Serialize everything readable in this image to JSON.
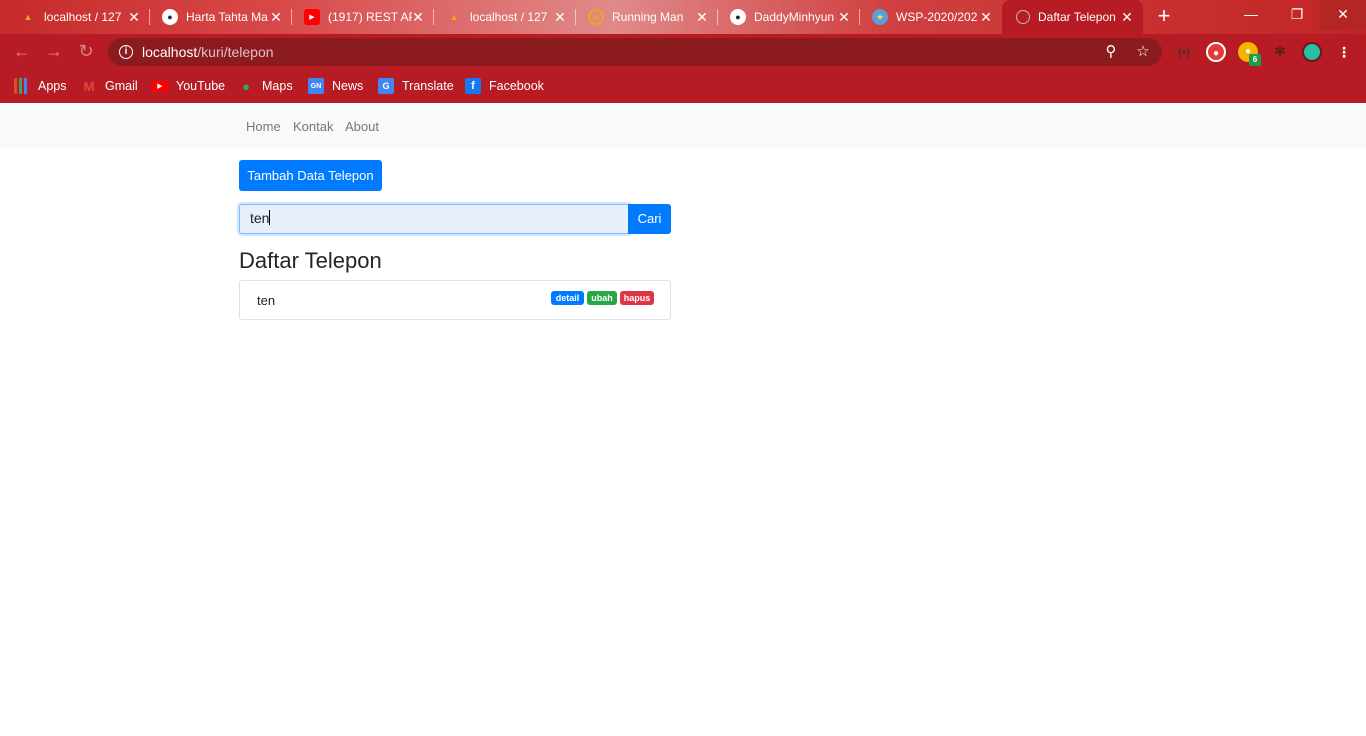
{
  "browser": {
    "tabs": [
      {
        "title": "localhost / 127",
        "favicon": "phpmyadmin-icon",
        "color": "#f4a21a"
      },
      {
        "title": "Harta Tahta Ma",
        "favicon": "avatar-icon",
        "color": "#ffffff"
      },
      {
        "title": "(1917) REST AP",
        "favicon": "youtube-icon",
        "color": "#ff0000"
      },
      {
        "title": "localhost / 127",
        "favicon": "phpmyadmin-icon",
        "color": "#f4a21a"
      },
      {
        "title": "Running Man",
        "favicon": "play-icon",
        "color": "#f7a21b"
      },
      {
        "title": "DaddyMinhyun",
        "favicon": "github-icon",
        "color": "#ffffff"
      },
      {
        "title": "WSP-2020/202",
        "favicon": "university-icon",
        "color": "#5aa0d8"
      },
      {
        "title": "Daftar Telepon",
        "favicon": "globe-icon",
        "color": "#c8c8c8",
        "active": true
      }
    ],
    "url_host": "localhost",
    "url_path": "/kuri/telepon",
    "bookmarks": [
      {
        "label": "Apps",
        "icon": "apps-grid-icon"
      },
      {
        "label": "Gmail",
        "icon": "gmail-icon"
      },
      {
        "label": "YouTube",
        "icon": "youtube-icon"
      },
      {
        "label": "Maps",
        "icon": "maps-icon"
      },
      {
        "label": "News",
        "icon": "news-icon"
      },
      {
        "label": "Translate",
        "icon": "translate-icon"
      },
      {
        "label": "Facebook",
        "icon": "facebook-icon"
      }
    ],
    "extension_badge": "6",
    "theme_color": "#b71c24"
  },
  "nav": {
    "links": [
      "Home",
      "Kontak",
      "About"
    ]
  },
  "actions": {
    "add_label": "Tambah Data Telepon"
  },
  "search": {
    "value": "ten",
    "button": "Cari"
  },
  "list": {
    "heading": "Daftar Telepon",
    "items": [
      {
        "name": "ten",
        "detail": "detail",
        "edit": "ubah",
        "delete": "hapus"
      }
    ]
  },
  "colors": {
    "primary": "#007bff",
    "success": "#28a745",
    "danger": "#dc3545"
  }
}
